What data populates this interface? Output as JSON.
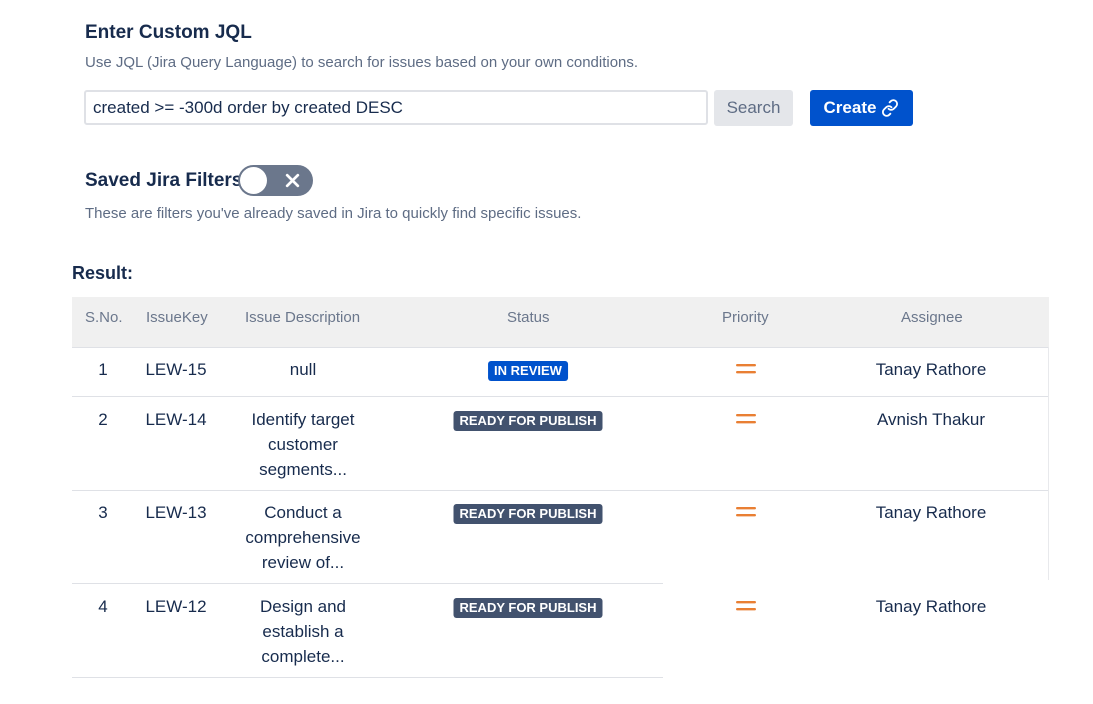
{
  "jql": {
    "title": "Enter Custom JQL",
    "description": "Use JQL (Jira Query Language) to search for issues based on your own conditions.",
    "query_value": "created >= -300d order by created DESC",
    "search_label": "Search",
    "create_label": "Create",
    "create_icon": "link-icon"
  },
  "saved_filters": {
    "title": "Saved Jira Filters",
    "toggle_state": "off",
    "toggle_icon": "close-icon",
    "description": "These are filters you've already saved in Jira to quickly find specific issues."
  },
  "result": {
    "label": "Result:",
    "columns": [
      "S.No.",
      "IssueKey",
      "Issue Description",
      "Status",
      "Priority",
      "Assignee"
    ],
    "rows": [
      {
        "sno": "1",
        "key": "LEW-15",
        "desc": "null",
        "status": "IN REVIEW",
        "priority_icon": "medium-priority-icon",
        "assignee": "Tanay Rathore"
      },
      {
        "sno": "2",
        "key": "LEW-14",
        "desc": "Identify target customer segments...",
        "status": "READY FOR PUBLISH",
        "priority_icon": "medium-priority-icon",
        "assignee": "Avnish Thakur"
      },
      {
        "sno": "3",
        "key": "LEW-13",
        "desc": "Conduct a comprehensive review of...",
        "status": "READY FOR PUBLISH",
        "priority_icon": "medium-priority-icon",
        "assignee": "Tanay Rathore"
      },
      {
        "sno": "4",
        "key": "LEW-12",
        "desc": "Design and establish a complete...",
        "status": "READY FOR PUBLISH",
        "priority_icon": "medium-priority-icon",
        "assignee": "Tanay Rathore"
      }
    ]
  },
  "colors": {
    "primary": "#0052cc",
    "status_review": "#0052cc",
    "status_ready": "#42526e",
    "priority_medium": "#e97f33",
    "toggle_off": "#6b778c"
  }
}
